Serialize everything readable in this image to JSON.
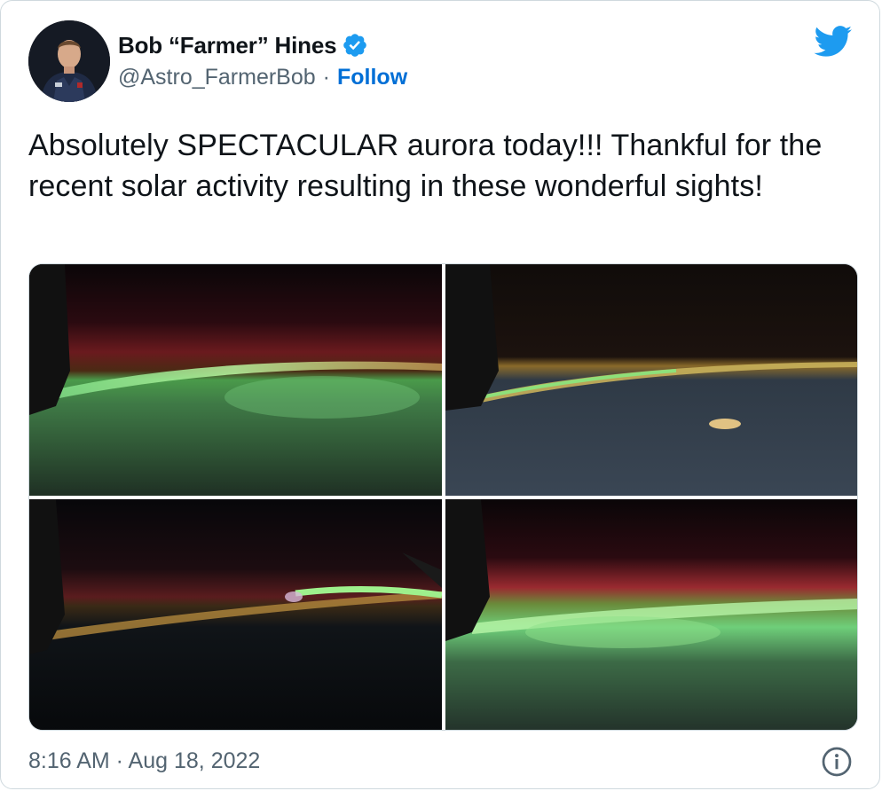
{
  "author": {
    "name": "Bob “Farmer” Hines",
    "handle": "@Astro_FarmerBob",
    "separator": "·",
    "follow_label": "Follow",
    "verified": true
  },
  "tweet": {
    "text": "Absolutely SPECTACULAR aurora today!!!  Thankful for the recent solar activity resulting in these wonderful sights!",
    "timestamp": "8:16 AM · Aug 18, 2022"
  },
  "media": [
    {
      "subject": "green and red aurora over Earth limb with spacecraft structure on left"
    },
    {
      "subject": "green airglow band over night-side Earth with city lights"
    },
    {
      "subject": "red and green aurora arc over dark Earth with spacecraft structure"
    },
    {
      "subject": "bright green aurora curtain with red glow above Earth"
    }
  ],
  "icons": {
    "brand": "twitter-bird-icon",
    "verified": "verified-badge-icon",
    "info": "info-icon"
  },
  "colors": {
    "brand_blue": "#1d9bf0",
    "follow_blue": "#006fd6",
    "text_primary": "#0f1419",
    "text_secondary": "#536471",
    "border": "#cfd9de"
  }
}
